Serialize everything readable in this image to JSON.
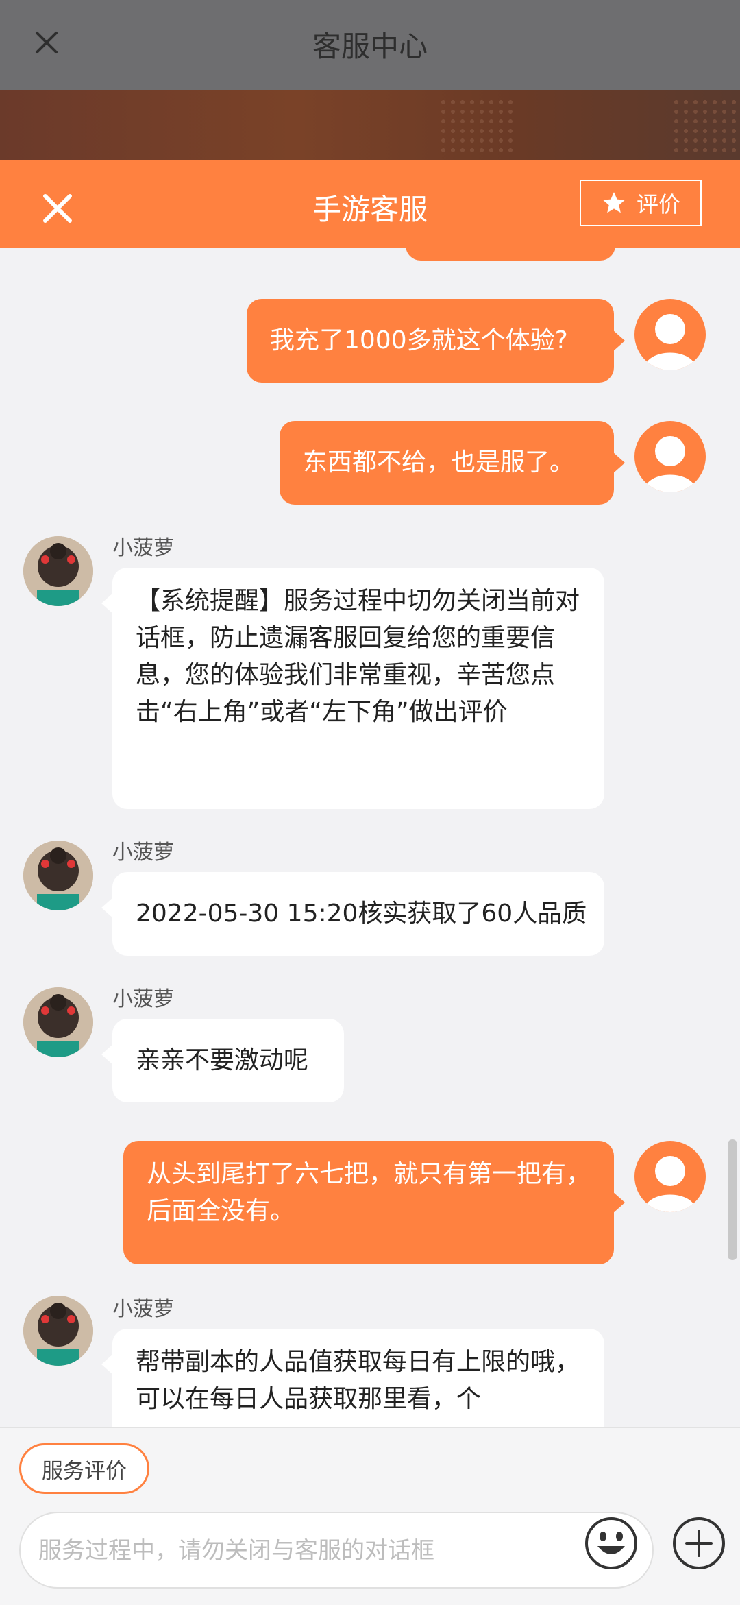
{
  "page": {
    "title": "客服中心"
  },
  "chat": {
    "title": "手游客服",
    "rate_label": "评价"
  },
  "messages": [
    {
      "side": "out",
      "text": "我充了1000多就这个体验?"
    },
    {
      "side": "out",
      "text": "东西都不给，也是服了。"
    },
    {
      "side": "in",
      "name": "小菠萝",
      "text": "【系统提醒】服务过程中切勿关闭当前对话框，防止遗漏客服回复给您的重要信息，您的体验我们非常重视，辛苦您点击“右上角”或者“左下角”做出评价"
    },
    {
      "side": "in",
      "name": "小菠萝",
      "text": "2022-05-30 15:20核实获取了60人品质"
    },
    {
      "side": "in",
      "name": "小菠萝",
      "text": "亲亲不要激动呢"
    },
    {
      "side": "out",
      "text": "从头到尾打了六七把，就只有第一把有，后面全没有。"
    },
    {
      "side": "in",
      "name": "小菠萝",
      "text": "帮带副本的人品值获取每日有上限的哦，可以在每日人品获取那里看，个"
    }
  ],
  "bottom": {
    "service_rate_label": "服务评价",
    "input_placeholder": "服务过程中，请勿关闭与客服的对话框"
  },
  "colors": {
    "accent": "#ff8140",
    "overlay_header": "#6e6e70",
    "background": "#f2f2f4"
  },
  "icons": {
    "page_close": "close-icon",
    "chat_close": "close-icon",
    "rate": "star-icon",
    "emoji": "emoji-icon",
    "plus": "plus-icon",
    "user_avatar": "user-avatar-icon"
  }
}
